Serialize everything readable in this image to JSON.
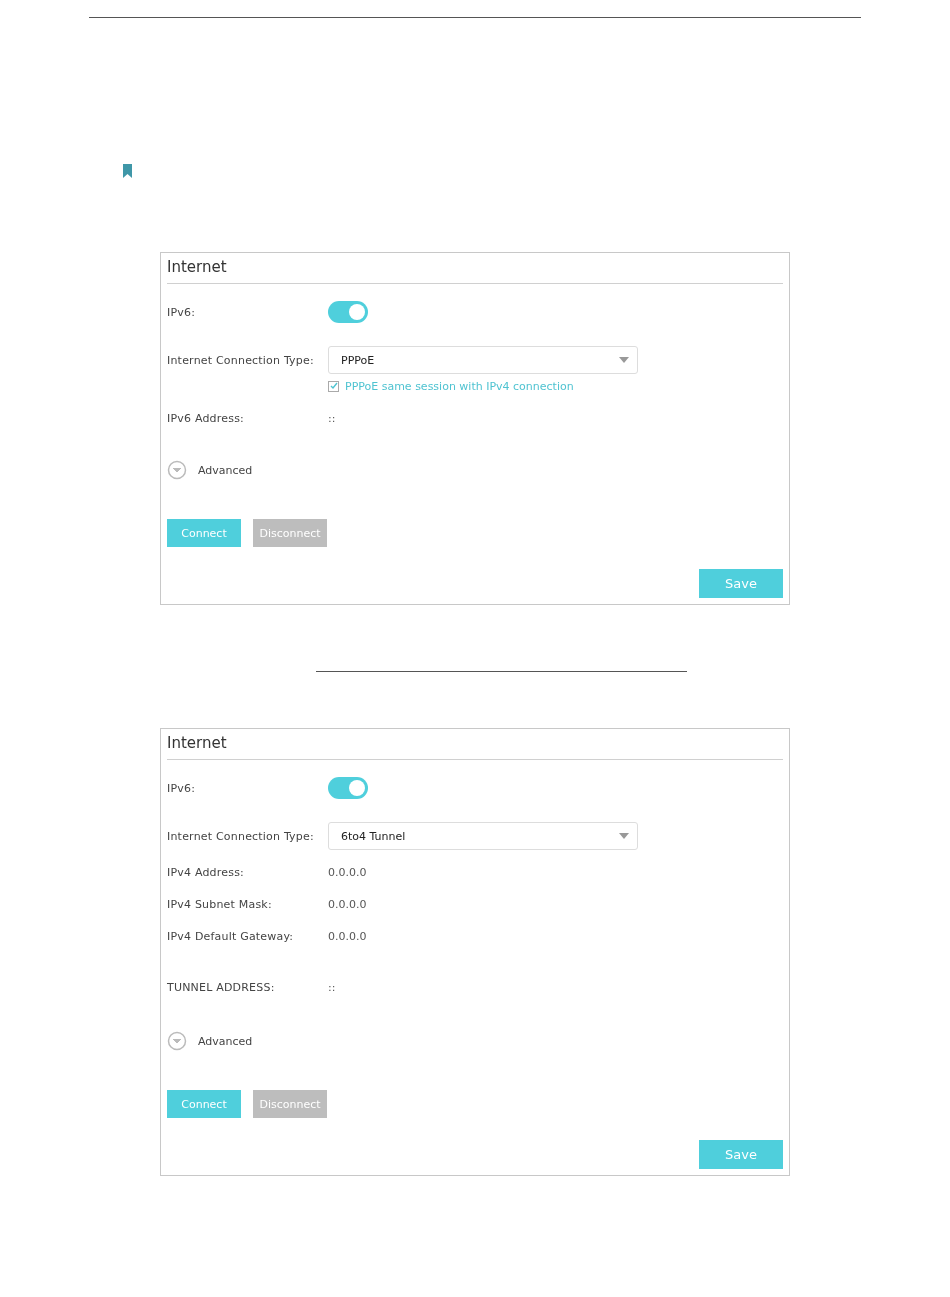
{
  "panels": [
    {
      "title": "Internet",
      "rows": [
        {
          "kind": "toggle",
          "label": "IPv6:",
          "on": true
        },
        {
          "kind": "select",
          "label": "Internet Connection Type:",
          "value": "PPPoE"
        },
        {
          "kind": "checkbox",
          "label": "PPPoE same session with IPv4 connection",
          "checked": true
        },
        {
          "kind": "field",
          "label": "IPv6 Address:",
          "value": "::"
        }
      ],
      "advanced": {
        "label": "Advanced",
        "expanded": false
      },
      "buttons": [
        {
          "label": "Connect",
          "disabled": false
        },
        {
          "label": "Disconnect",
          "disabled": true
        }
      ],
      "save": "Save"
    },
    {
      "title": "Internet",
      "rows": [
        {
          "kind": "toggle",
          "label": "IPv6:",
          "on": true
        },
        {
          "kind": "select",
          "label": "Internet Connection Type:",
          "value": "6to4 Tunnel"
        },
        {
          "kind": "field",
          "label": "IPv4 Address:",
          "value": "0.0.0.0"
        },
        {
          "kind": "field",
          "label": "IPv4 Subnet Mask:",
          "value": "0.0.0.0"
        },
        {
          "kind": "field",
          "label": "IPv4 Default Gateway:",
          "value": "0.0.0.0"
        },
        {
          "kind": "gapfield",
          "label": "TUNNEL ADDRESS:",
          "value": "::"
        }
      ],
      "advanced": {
        "label": "Advanced",
        "expanded": false
      },
      "buttons": [
        {
          "label": "Connect",
          "disabled": false
        },
        {
          "label": "Disconnect",
          "disabled": true
        }
      ],
      "save": "Save"
    }
  ]
}
